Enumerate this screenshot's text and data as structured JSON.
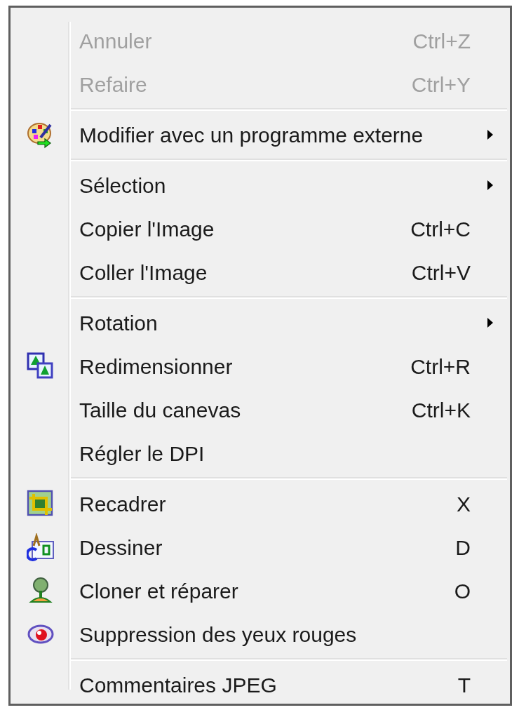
{
  "menu": {
    "items": [
      {
        "kind": "item",
        "label": "Annuler",
        "shortcut": "Ctrl+Z",
        "disabled": true,
        "submenu": false
      },
      {
        "kind": "item",
        "label": "Refaire",
        "shortcut": "Ctrl+Y",
        "disabled": true,
        "submenu": false
      },
      {
        "kind": "separator"
      },
      {
        "kind": "item",
        "label": "Modifier avec un programme externe",
        "disabled": false,
        "submenu": true
      },
      {
        "kind": "separator"
      },
      {
        "kind": "item",
        "label": "Sélection",
        "disabled": false,
        "submenu": true
      },
      {
        "kind": "item",
        "label": "Copier l'Image",
        "shortcut": "Ctrl+C",
        "disabled": false,
        "submenu": false
      },
      {
        "kind": "item",
        "label": "Coller l'Image",
        "shortcut": "Ctrl+V",
        "disabled": false,
        "submenu": false
      },
      {
        "kind": "separator"
      },
      {
        "kind": "item",
        "label": "Rotation",
        "disabled": false,
        "submenu": true
      },
      {
        "kind": "item",
        "label": "Redimensionner",
        "shortcut": "Ctrl+R",
        "disabled": false,
        "submenu": false
      },
      {
        "kind": "item",
        "label": "Taille du canevas",
        "shortcut": "Ctrl+K",
        "disabled": false,
        "submenu": false
      },
      {
        "kind": "item",
        "label": "Régler le DPI",
        "disabled": false,
        "submenu": false
      },
      {
        "kind": "separator"
      },
      {
        "kind": "item",
        "label": "Recadrer",
        "shortcut": "X",
        "disabled": false,
        "submenu": false
      },
      {
        "kind": "item",
        "label": "Dessiner",
        "shortcut": "D",
        "disabled": false,
        "submenu": false
      },
      {
        "kind": "item",
        "label": "Cloner et réparer",
        "shortcut": "O",
        "disabled": false,
        "submenu": false
      },
      {
        "kind": "item",
        "label": "Suppression des yeux rouges",
        "disabled": false,
        "submenu": false
      },
      {
        "kind": "separator"
      },
      {
        "kind": "item",
        "label": "Commentaires JPEG",
        "shortcut": "T",
        "disabled": false,
        "submenu": false
      }
    ]
  }
}
